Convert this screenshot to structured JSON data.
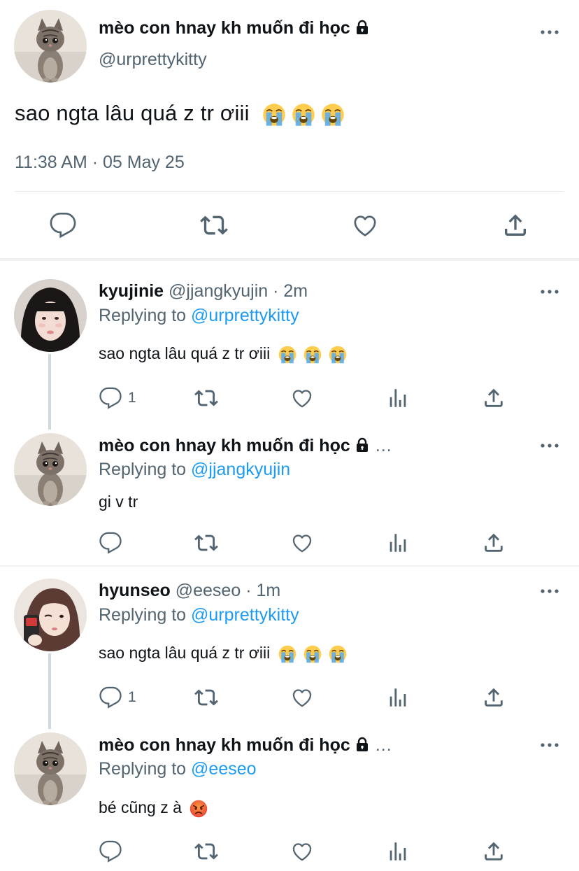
{
  "main_tweet": {
    "author_name": "mèo con hnay kh muốn đi học",
    "author_handle": "@urprettykitty",
    "text": "sao ngta lâu quá z tr ơiii",
    "emojis": [
      "loudly-crying-face",
      "loudly-crying-face",
      "loudly-crying-face"
    ],
    "timestamp": "11:38 AM · 05 May 25",
    "actions": [
      "reply-icon",
      "retweet-icon",
      "like-icon",
      "share-icon"
    ]
  },
  "replies": [
    {
      "author_name": "kyujinie",
      "meta": "@jjangkyujin · 2m",
      "replying_prefix": "Replying to ",
      "replying_to": "@urprettykitty",
      "text": "sao ngta lâu quá z tr ơiii",
      "emojis": [
        "loudly-crying-face",
        "loudly-crying-face",
        "loudly-crying-face"
      ],
      "reply_count": "1",
      "avatar": "girl-photo-avatar"
    },
    {
      "author_name": "mèo con hnay kh muốn đi học",
      "meta": "…",
      "replying_prefix": "Replying to ",
      "replying_to": "@jjangkyujin",
      "text": "gi v tr",
      "emojis": [],
      "reply_count": "",
      "avatar": "kitten-avatar"
    },
    {
      "author_name": "hyunseo",
      "meta": "@eeseo · 1m",
      "replying_prefix": "Replying to ",
      "replying_to": "@urprettykitty",
      "text": "sao ngta lâu quá z tr ơiii",
      "emojis": [
        "loudly-crying-face",
        "loudly-crying-face",
        "loudly-crying-face"
      ],
      "reply_count": "1",
      "avatar": "girl-photo-avatar"
    },
    {
      "author_name": "mèo con hnay kh muốn đi học",
      "meta": "…",
      "replying_prefix": "Replying to ",
      "replying_to": "@eeseo",
      "text": "bé cũng z à",
      "emojis": [
        "angry-face"
      ],
      "reply_count": "",
      "avatar": "kitten-avatar"
    }
  ],
  "colors": {
    "link": "#1d9bf0",
    "secondary_text": "#536471",
    "primary_text": "#0f1419",
    "divider": "#e7e9ec",
    "thread_line": "#cfd9de"
  }
}
